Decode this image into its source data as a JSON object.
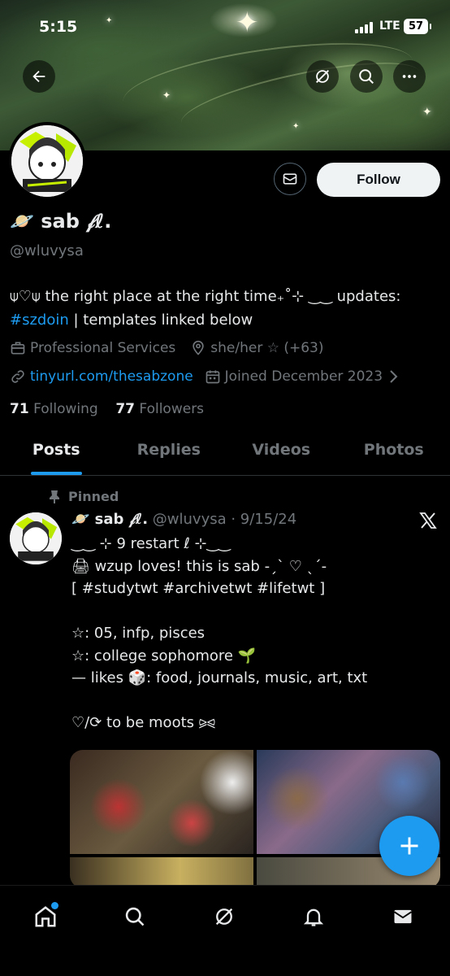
{
  "status_bar": {
    "time": "5:15",
    "network": "LTE",
    "battery": "57"
  },
  "profile": {
    "name": "🪐 sab 𝒻ℓ.",
    "handle": "@wluvysa",
    "bio_prefix": "⍦♡⍦ the right place at the right time₊˚⊹ ‿‿ updates:",
    "bio_hashtag": "#szdoin",
    "bio_suffix": " | templates linked below",
    "category": "Professional Services",
    "location": "she/her ☆ (+63)",
    "website": "tinyurl.com/thesabzone",
    "joined": "Joined December 2023",
    "following_count": "71",
    "following_label": "Following",
    "followers_count": "77",
    "followers_label": "Followers",
    "follow_label": "Follow"
  },
  "tabs": [
    {
      "label": "Posts"
    },
    {
      "label": "Replies"
    },
    {
      "label": "Videos"
    },
    {
      "label": "Photos"
    }
  ],
  "post": {
    "pinned_label": "Pinned",
    "author": "🪐 sab 𝒻ℓ.",
    "meta": "@wluvysa · 9/15/24",
    "text": "‿‿ ⊹ 9 restart ℓ ⊹‿‿\n🖨 wzup loves! this is sab -ˏˋ ♡ ˎˊ-\n[ #studytwt #archivetwt #lifetwt ]\n\n☆: 05, infp, pisces\n☆: college sophomore 🌱\n— likes 🎲: food, journals, music, art, txt\n\n♡/⟳ to be moots ⪩⪨"
  },
  "colors": {
    "accent": "#1d9bf0",
    "muted": "#71767b",
    "text": "#e7e9ea"
  }
}
